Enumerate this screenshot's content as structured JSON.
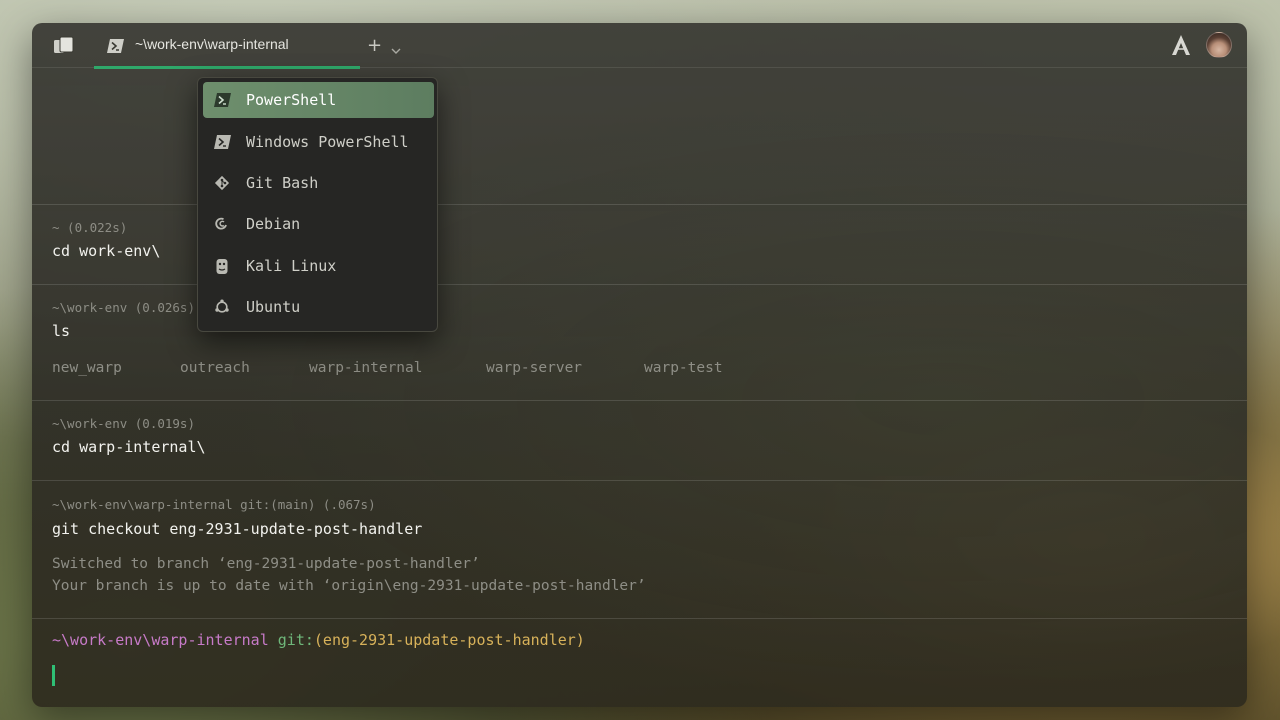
{
  "window": {
    "tab_title": "~\\work-env\\warp-internal",
    "accent": "#2fa86a"
  },
  "shell_menu": {
    "items": [
      {
        "label": "PowerShell",
        "icon": "powershell-icon",
        "active": true
      },
      {
        "label": "Windows PowerShell",
        "icon": "powershell-icon",
        "active": false
      },
      {
        "label": "Git Bash",
        "icon": "git-icon",
        "active": false
      },
      {
        "label": "Debian",
        "icon": "debian-icon",
        "active": false
      },
      {
        "label": "Kali Linux",
        "icon": "kali-linux-icon",
        "active": false
      },
      {
        "label": "Ubuntu",
        "icon": "ubuntu-icon",
        "active": false
      }
    ]
  },
  "blocks": [
    {
      "meta": "~ (0.022s)",
      "command": "cd work-env\\"
    },
    {
      "meta": "~\\work-env (0.026s)",
      "command": "ls",
      "ls_output": [
        "new_warp",
        "outreach",
        "warp-internal",
        "warp-server",
        "warp-test"
      ]
    },
    {
      "meta": "~\\work-env (0.019s)",
      "command": "cd warp-internal\\"
    },
    {
      "meta": "~\\work-env\\warp-internal git:(main) (.067s)",
      "command": "git checkout eng-2931-update-post-handler",
      "output": [
        "Switched to branch ‘eng-2931-update-post-handler’",
        "Your branch is up to date with ‘origin\\eng-2931-update-post-handler’"
      ]
    }
  ],
  "prompt": {
    "path": "~\\work-env\\warp-internal",
    "git_label": "git:",
    "branch": "(eng-2931-update-post-handler)",
    "colors": {
      "path": "#c77ac8",
      "git": "#6fb77a",
      "branch": "#d8b25a"
    }
  }
}
